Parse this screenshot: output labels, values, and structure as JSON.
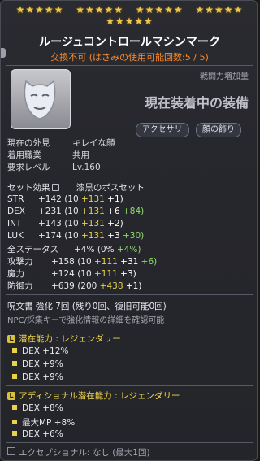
{
  "stars": {
    "groups": [
      "★★★★★",
      "★★★★★",
      "★★★★★",
      "★★★★★",
      "★★★★★"
    ]
  },
  "item": {
    "name": "ルージュコントロールマシンマーク",
    "trade_status": "交換不可 (はさみの使用可能回数:5 / 5)",
    "icon": "mask-icon"
  },
  "right": {
    "atk_label": "戦闘力増加量",
    "equipped_label": "現在装着中の装備",
    "tags": [
      "アクセサリ",
      "顔の飾り"
    ]
  },
  "info": {
    "appearance_label": "現在の外見",
    "appearance_value": "キレイな顔",
    "job_label": "着用職業",
    "job_value": "共用",
    "level_label": "要求レベル",
    "level_value": "Lv.160"
  },
  "set": {
    "label": "セット効果",
    "value": "漆黒のボスセット"
  },
  "stats": [
    {
      "name": "STR",
      "total": "+142",
      "base": "(10 ",
      "flame": "+131",
      "star": " +1)",
      "extra": ""
    },
    {
      "name": "DEX",
      "total": "+231",
      "base": "(10 ",
      "flame": "+131",
      "star": " +6",
      "extra": " +84)"
    },
    {
      "name": "INT",
      "total": "+143",
      "base": "(10 ",
      "flame": "+131",
      "star": " +2)",
      "extra": ""
    },
    {
      "name": "LUK",
      "total": "+174",
      "base": "(10 ",
      "flame": "+131",
      "star": " +3",
      "extra": " +30)"
    },
    {
      "name": "全ステータス",
      "total": "+4%",
      "base": "(0% ",
      "flame": "",
      "star": "",
      "extra": "+4%)"
    },
    {
      "name": "攻撃力",
      "total": "+158",
      "base": "(10 ",
      "flame": "+111",
      "star": " +31",
      "extra": " +6)"
    },
    {
      "name": "魔力",
      "total": "+124",
      "base": "(10 ",
      "flame": "+111",
      "star": " +3)",
      "extra": ""
    },
    {
      "name": "防御力",
      "total": "+639",
      "base": "(200 ",
      "flame": "+438",
      "star": " +1)",
      "extra": ""
    }
  ],
  "scroll": {
    "text": "呪文書 強化 7回 (残り0回、復旧可能0回)"
  },
  "hint": {
    "text": "NPC/採集キーで強化情報の詳細を確認可能"
  },
  "potential": {
    "label": "潜在能力 : レジェンダリー",
    "badge": "L",
    "lines": [
      "DEX +12%",
      "DEX +9%",
      "DEX +9%"
    ]
  },
  "additional": {
    "label": "アディショナル潜在能力 : レジェンダリー",
    "badge": "L",
    "lines": [
      "DEX +8%",
      "最大MP +8%",
      "DEX +6%"
    ]
  },
  "exceptional": {
    "text": "エクセプショナル: なし (最大1回)"
  },
  "colors": {
    "accent_yellow": "#e7d24a",
    "accent_green": "#8fe06a",
    "accent_orange": "#ff8b2b"
  }
}
